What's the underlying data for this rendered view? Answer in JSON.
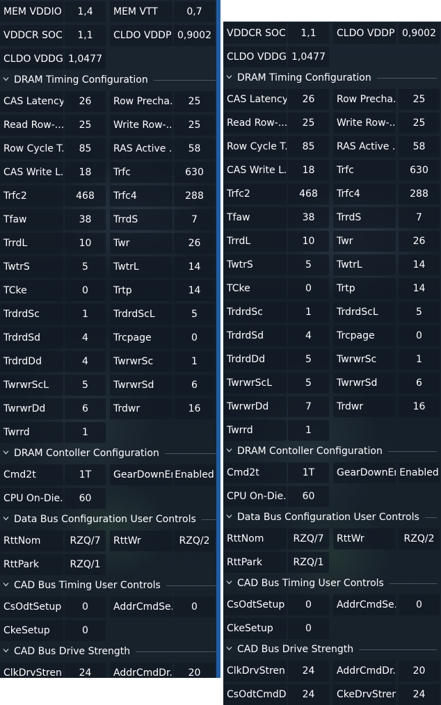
{
  "left": {
    "rows": [
      {
        "type": "row",
        "cells": [
          "MEM VDDIO",
          "1,4",
          "MEM VTT",
          "0,7"
        ]
      },
      {
        "type": "row",
        "cells": [
          "VDDCR SOC",
          "1,1",
          "CLDO VDDP",
          "0,9002"
        ]
      },
      {
        "type": "row",
        "cells": [
          "CLDO VDDG",
          "1,0477"
        ]
      },
      {
        "type": "section",
        "title": "DRAM Timing Configuration"
      },
      {
        "type": "row",
        "cells": [
          "CAS Latency",
          "26",
          "Row Precha...",
          "25"
        ]
      },
      {
        "type": "row",
        "cells": [
          "Read Row-...",
          "25",
          "Write Row-...",
          "25"
        ]
      },
      {
        "type": "row",
        "cells": [
          "Row Cycle T...",
          "85",
          "RAS Active ...",
          "58"
        ]
      },
      {
        "type": "row",
        "cells": [
          "CAS Write L...",
          "18",
          "Trfc",
          "630"
        ]
      },
      {
        "type": "row",
        "cells": [
          "Trfc2",
          "468",
          "Trfc4",
          "288"
        ]
      },
      {
        "type": "row",
        "cells": [
          "Tfaw",
          "38",
          "TrrdS",
          "7"
        ]
      },
      {
        "type": "row",
        "cells": [
          "TrrdL",
          "10",
          "Twr",
          "26"
        ]
      },
      {
        "type": "row",
        "cells": [
          "TwtrS",
          "5",
          "TwtrL",
          "14"
        ]
      },
      {
        "type": "row",
        "cells": [
          "TCke",
          "0",
          "Trtp",
          "14"
        ]
      },
      {
        "type": "row",
        "cells": [
          "TrdrdSc",
          "1",
          "TrdrdScL",
          "5"
        ]
      },
      {
        "type": "row",
        "cells": [
          "TrdrdSd",
          "4",
          "Trcpage",
          "0"
        ]
      },
      {
        "type": "row",
        "cells": [
          "TrdrdDd",
          "4",
          "TwrwrSc",
          "1"
        ]
      },
      {
        "type": "row",
        "cells": [
          "TwrwrScL",
          "5",
          "TwrwrSd",
          "6"
        ]
      },
      {
        "type": "row",
        "cells": [
          "TwrwrDd",
          "6",
          "Trdwr",
          "16"
        ]
      },
      {
        "type": "row",
        "cells": [
          "Twrrd",
          "1"
        ]
      },
      {
        "type": "section",
        "title": "DRAM Contoller Configuration"
      },
      {
        "type": "row",
        "cells": [
          "Cmd2t",
          "1T",
          "GearDownEn",
          "Enabled"
        ]
      },
      {
        "type": "row",
        "cells": [
          "CPU On-Die...",
          "60"
        ]
      },
      {
        "type": "section",
        "title": "Data Bus Configuration User Controls"
      },
      {
        "type": "row",
        "cells": [
          "RttNom",
          "RZQ/7",
          "RttWr",
          "RZQ/2"
        ]
      },
      {
        "type": "row",
        "cells": [
          "RttPark",
          "RZQ/1"
        ]
      },
      {
        "type": "section",
        "title": "CAD Bus Timing User Controls"
      },
      {
        "type": "row",
        "cells": [
          "CsOdtSetup",
          "0",
          "AddrCmdSe...",
          "0"
        ]
      },
      {
        "type": "row",
        "cells": [
          "CkeSetup",
          "0"
        ]
      },
      {
        "type": "section",
        "title": "CAD Bus Drive Strength"
      },
      {
        "type": "row",
        "cells": [
          "ClkDrvStren",
          "24",
          "AddrCmdDr...",
          "20"
        ]
      }
    ]
  },
  "right": {
    "rows": [
      {
        "type": "row",
        "cells": [
          "VDDCR SOC",
          "1,1",
          "CLDO VDDP",
          "0,9002"
        ]
      },
      {
        "type": "row",
        "cells": [
          "CLDO VDDG",
          "1,0477"
        ]
      },
      {
        "type": "section",
        "title": "DRAM Timing Configuration"
      },
      {
        "type": "row",
        "cells": [
          "CAS Latency",
          "26",
          "Row Precha...",
          "25"
        ]
      },
      {
        "type": "row",
        "cells": [
          "Read Row-...",
          "25",
          "Write Row-...",
          "25"
        ]
      },
      {
        "type": "row",
        "cells": [
          "Row Cycle T...",
          "85",
          "RAS Active ...",
          "58"
        ]
      },
      {
        "type": "row",
        "cells": [
          "CAS Write L...",
          "18",
          "Trfc",
          "630"
        ]
      },
      {
        "type": "row",
        "cells": [
          "Trfc2",
          "468",
          "Trfc4",
          "288"
        ]
      },
      {
        "type": "row",
        "cells": [
          "Tfaw",
          "38",
          "TrrdS",
          "7"
        ]
      },
      {
        "type": "row",
        "cells": [
          "TrrdL",
          "10",
          "Twr",
          "26"
        ]
      },
      {
        "type": "row",
        "cells": [
          "TwtrS",
          "5",
          "TwtrL",
          "14"
        ]
      },
      {
        "type": "row",
        "cells": [
          "TCke",
          "0",
          "Trtp",
          "14"
        ]
      },
      {
        "type": "row",
        "cells": [
          "TrdrdSc",
          "1",
          "TrdrdScL",
          "5"
        ]
      },
      {
        "type": "row",
        "cells": [
          "TrdrdSd",
          "4",
          "Trcpage",
          "0"
        ]
      },
      {
        "type": "row",
        "cells": [
          "TrdrdDd",
          "5",
          "TwrwrSc",
          "1"
        ]
      },
      {
        "type": "row",
        "cells": [
          "TwrwrScL",
          "5",
          "TwrwrSd",
          "6"
        ]
      },
      {
        "type": "row",
        "cells": [
          "TwrwrDd",
          "7",
          "Trdwr",
          "16"
        ]
      },
      {
        "type": "row",
        "cells": [
          "Twrrd",
          "1"
        ]
      },
      {
        "type": "section",
        "title": "DRAM Contoller Configuration"
      },
      {
        "type": "row",
        "cells": [
          "Cmd2t",
          "1T",
          "GearDownEn",
          "Enabled"
        ]
      },
      {
        "type": "row",
        "cells": [
          "CPU On-Die...",
          "60"
        ]
      },
      {
        "type": "section",
        "title": "Data Bus Configuration User Controls"
      },
      {
        "type": "row",
        "cells": [
          "RttNom",
          "RZQ/7",
          "RttWr",
          "RZQ/2"
        ]
      },
      {
        "type": "row",
        "cells": [
          "RttPark",
          "RZQ/1"
        ]
      },
      {
        "type": "section",
        "title": "CAD Bus Timing User Controls"
      },
      {
        "type": "row",
        "cells": [
          "CsOdtSetup",
          "0",
          "AddrCmdSe...",
          "0"
        ]
      },
      {
        "type": "row",
        "cells": [
          "CkeSetup",
          "0"
        ]
      },
      {
        "type": "section",
        "title": "CAD Bus Drive Strength"
      },
      {
        "type": "row",
        "cells": [
          "ClkDrvStren",
          "24",
          "AddrCmdDr...",
          "20"
        ]
      },
      {
        "type": "row",
        "cells": [
          "CsOdtCmdD...",
          "24",
          "CkeDrvStren",
          "24"
        ]
      }
    ]
  },
  "theme": {
    "accent": "#1d5ea8",
    "cell_bg": "#121a24",
    "text": "#ffffff",
    "section_chevron": "chevron-down-icon"
  }
}
